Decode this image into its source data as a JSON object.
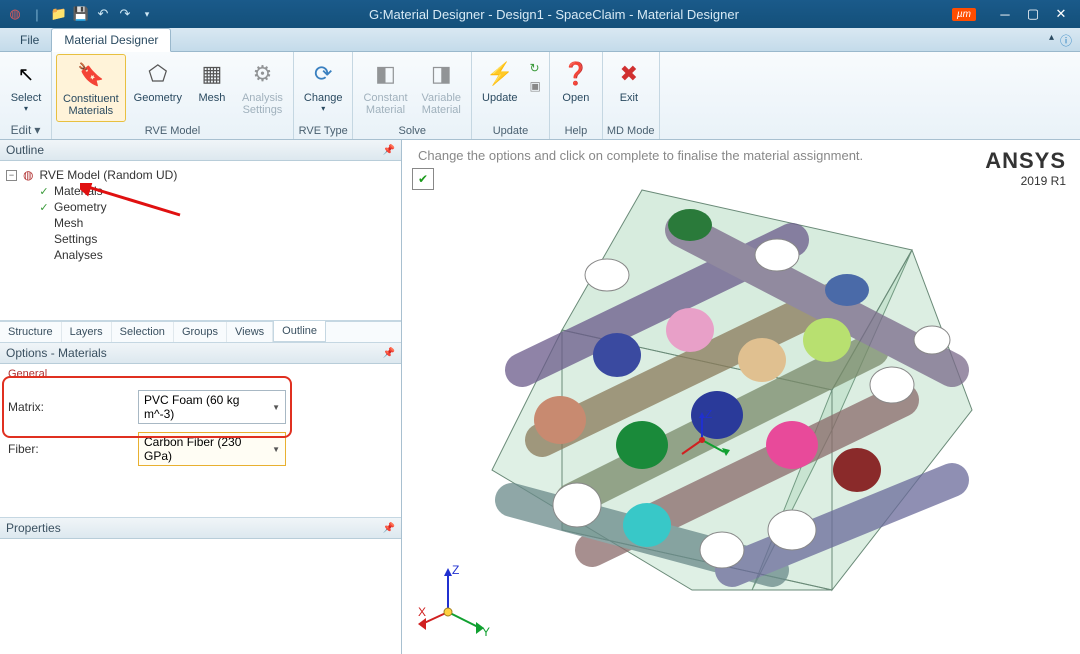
{
  "titlebar": {
    "title": "G:Material Designer - Design1 - SpaceClaim - Material Designer",
    "unit_badge": "µm"
  },
  "menu": {
    "file": "File",
    "material_designer": "Material Designer"
  },
  "ribbon": {
    "select": "Select",
    "edit": "Edit",
    "constituent_materials": "Constituent\nMaterials",
    "geometry": "Geometry",
    "mesh": "Mesh",
    "analysis_settings": "Analysis\nSettings",
    "group_rve_model": "RVE Model",
    "change": "Change",
    "group_rve_type": "RVE Type",
    "constant_material": "Constant\nMaterial",
    "variable_material": "Variable\nMaterial",
    "group_solve": "Solve",
    "update": "Update",
    "group_update": "Update",
    "open": "Open",
    "group_help": "Help",
    "exit": "Exit",
    "group_mdmode": "MD Mode"
  },
  "outline": {
    "header": "Outline",
    "root": "RVE Model (Random UD)",
    "items": [
      "Materials",
      "Geometry",
      "Mesh",
      "Settings",
      "Analyses"
    ],
    "tabs": [
      "Structure",
      "Layers",
      "Selection",
      "Groups",
      "Views",
      "Outline"
    ]
  },
  "options": {
    "header": "Options - Materials",
    "general": "General",
    "matrix_label": "Matrix:",
    "matrix_value": "PVC Foam (60 kg m^-3)",
    "fiber_label": "Fiber:",
    "fiber_value": "Carbon Fiber (230 GPa)"
  },
  "properties": {
    "header": "Properties"
  },
  "viewport": {
    "hint": "Change the options and click on complete to finalise the material assignment.",
    "brand": "ANSYS",
    "version": "2019 R1",
    "axes": {
      "x": "X",
      "y": "Y",
      "z": "Z"
    }
  }
}
